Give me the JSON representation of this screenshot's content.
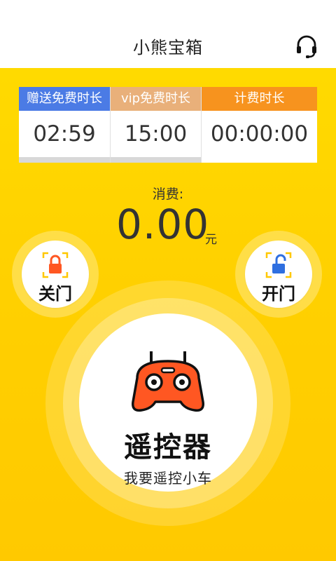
{
  "header": {
    "title": "小熊宝箱",
    "support_icon": "headset-icon"
  },
  "timers": [
    {
      "label": "赠送免费时长",
      "value": "02:59",
      "color": "#4B7BE5"
    },
    {
      "label": "vip免费时长",
      "value": "15:00",
      "color": "#E9B07A"
    },
    {
      "label": "计费时长",
      "value": "00:00:00",
      "color": "#F7931E"
    }
  ],
  "fee": {
    "label": "消费:",
    "amount": "0.00",
    "unit": "元"
  },
  "lock_button": {
    "label": "关门",
    "icon": "lock-closed-icon",
    "color": "#FF5722"
  },
  "unlock_button": {
    "label": "开门",
    "icon": "lock-open-icon",
    "color": "#2F6FE0"
  },
  "remote": {
    "title": "遥控器",
    "subtitle": "我要遥控小车",
    "icon": "robot-icon",
    "color": "#FF5722"
  }
}
